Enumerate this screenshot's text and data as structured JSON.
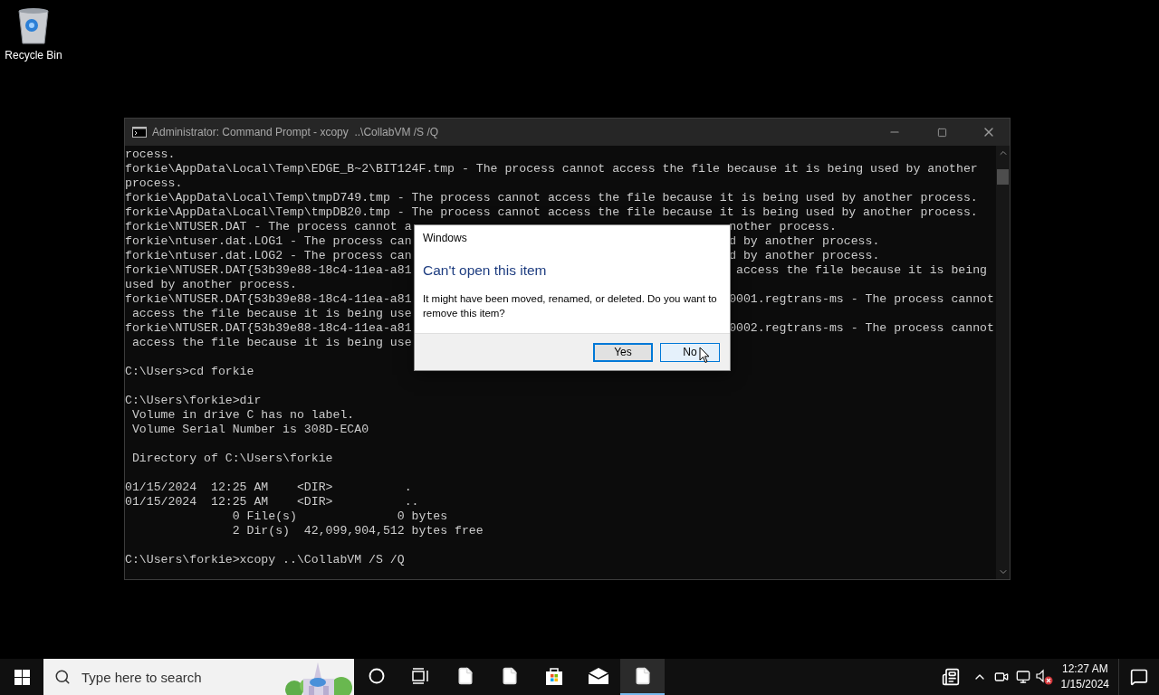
{
  "desktop": {
    "icons": [
      {
        "label": "Recycle Bin"
      }
    ]
  },
  "console": {
    "title": "Administrator: Command Prompt - xcopy  ..\\CollabVM /S /Q",
    "blocks": [
      {
        "lines": [
          {
            "text": "rocess."
          },
          {
            "text": "forkie\\AppData\\Local\\Temp\\EDGE_B~2\\BIT124F.tmp - The process cannot access the file because it is being used by another"
          },
          {
            "text": "process."
          },
          {
            "text": "forkie\\AppData\\Local\\Temp\\tmpD749.tmp - The process cannot access the file because it is being used by another process."
          },
          {
            "text": "forkie\\AppData\\Local\\Temp\\tmpDB20.tmp - The process cannot access the file because it is being used by another process."
          },
          {
            "text": "forkie\\NTUSER.DAT - The process cannot a",
            "right": "nother process."
          },
          {
            "text": "forkie\\ntuser.dat.LOG1 - The process can",
            "right": "d by another process."
          },
          {
            "text": "forkie\\ntuser.dat.LOG2 - The process can",
            "right": "d by another process."
          },
          {
            "text": "forkie\\NTUSER.DAT{53b39e88-18c4-11ea-a81",
            "right": " access the file because it is being"
          },
          {
            "text": "used by another process."
          },
          {
            "text": "forkie\\NTUSER.DAT{53b39e88-18c4-11ea-a81",
            "right": "0001.regtrans-ms - The process cannot"
          },
          {
            "text": " access the file because it is being use"
          },
          {
            "text": "forkie\\NTUSER.DAT{53b39e88-18c4-11ea-a81",
            "right": "0002.regtrans-ms - The process cannot"
          },
          {
            "text": " access the file because it is being use"
          }
        ]
      },
      {
        "lines": [
          {
            "text": "C:\\Users>cd forkie"
          }
        ]
      },
      {
        "lines": [
          {
            "text": "C:\\Users\\forkie>dir"
          },
          {
            "text": " Volume in drive C has no label."
          },
          {
            "text": " Volume Serial Number is 308D-ECA0"
          }
        ]
      },
      {
        "lines": [
          {
            "text": " Directory of C:\\Users\\forkie"
          }
        ]
      },
      {
        "lines": [
          {
            "text": "01/15/2024  12:25 AM    <DIR>          ."
          },
          {
            "text": "01/15/2024  12:25 AM    <DIR>          .."
          },
          {
            "text": "               0 File(s)              0 bytes"
          },
          {
            "text": "               2 Dir(s)  42,099,904,512 bytes free"
          }
        ]
      },
      {
        "lines": [
          {
            "text": "C:\\Users\\forkie>xcopy ..\\CollabVM /S /Q"
          }
        ]
      }
    ]
  },
  "dialog": {
    "caption": "Windows",
    "heading": "Can't open this item",
    "message": "It might have been moved, renamed, or deleted. Do you want to remove this item?",
    "buttons": [
      {
        "label": "Yes",
        "selected": true,
        "hovered": false
      },
      {
        "label": "No",
        "selected": false,
        "hovered": true
      }
    ]
  },
  "taskbar": {
    "search": {
      "placeholder": "Type here to search"
    },
    "apps": [
      {
        "kind": "cortana",
        "active": false
      },
      {
        "kind": "taskview",
        "active": false
      },
      {
        "kind": "file",
        "active": false
      },
      {
        "kind": "file",
        "active": false
      },
      {
        "kind": "store",
        "active": false
      },
      {
        "kind": "mail",
        "active": false
      },
      {
        "kind": "file",
        "active": true
      }
    ],
    "clock": {
      "time": "12:27 AM",
      "date": "1/15/2024"
    }
  }
}
